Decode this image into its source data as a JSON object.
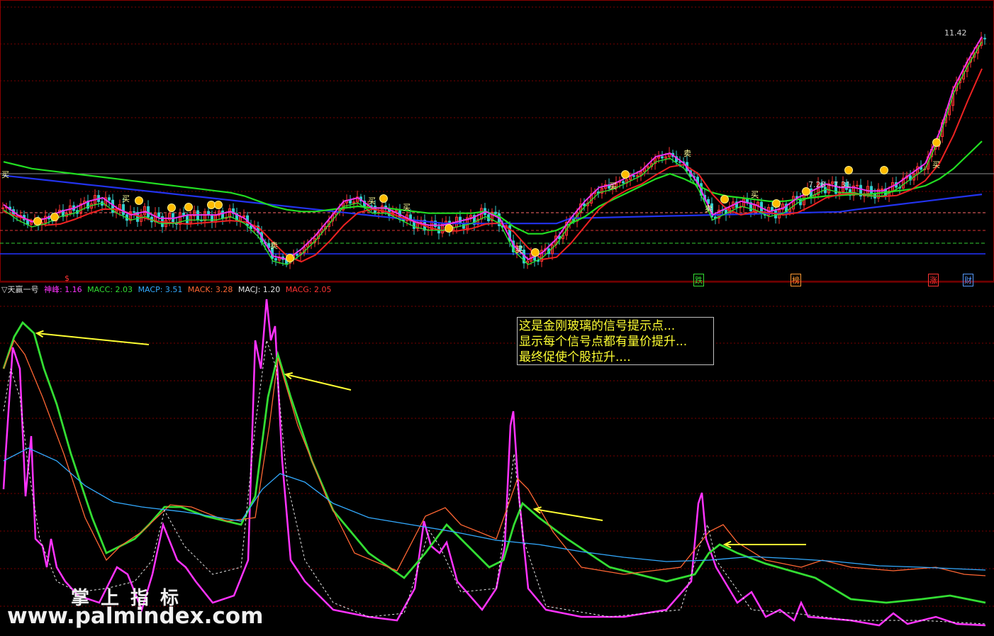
{
  "legend": {
    "title": "▽天赢一号",
    "items": [
      {
        "label": "神峰: 1.16",
        "color": "#ff33ff"
      },
      {
        "label": "MACC: 2.03",
        "color": "#33dd33"
      },
      {
        "label": "MACP: 3.51",
        "color": "#33aaff"
      },
      {
        "label": "MACK: 3.28",
        "color": "#ff6633"
      },
      {
        "label": "MACJ: 1.20",
        "color": "#e0e0e0"
      },
      {
        "label": "MACG: 2.05",
        "color": "#ff3333"
      }
    ]
  },
  "annotation": {
    "lines": [
      "这是金刚玻璃的信号提示点...",
      "显示每个信号点都有量价提升...",
      "最终促使个股拉升...."
    ]
  },
  "watermark": {
    "cn": "掌上指标",
    "url": "www.palmindex.com"
  },
  "price_labels": {
    "high": "11.42",
    "mid": "7.28 - 7.31"
  },
  "signal_marks": {
    "buy": "买",
    "sell": "卖",
    "dollar": "$"
  },
  "bottom_tags": [
    {
      "text": "跌",
      "color": "#33dd33"
    },
    {
      "text": "榜",
      "color": "#ff9933"
    },
    {
      "text": "涨",
      "color": "#ff3333"
    },
    {
      "text": "财",
      "color": "#5599ff"
    }
  ],
  "colors": {
    "up": "#ff3333",
    "down": "#33cccc",
    "ma_green": "#22dd22",
    "ma_red": "#ee2222",
    "ma_blue": "#2233ee",
    "ma_magenta": "#ee33ee",
    "grid": "#7a0000",
    "arrow": "#ffff33"
  },
  "chart_data": [
    {
      "type": "line",
      "panel": "price",
      "x": [
        0,
        20,
        40,
        60,
        80,
        100,
        120,
        140,
        160,
        180,
        200,
        220,
        240,
        260,
        280,
        300,
        320,
        340,
        360,
        380,
        400,
        420,
        440,
        460,
        480,
        500,
        520,
        540,
        560,
        580,
        600,
        620,
        640,
        660,
        680,
        700,
        720,
        740,
        760,
        780,
        800,
        820,
        840,
        860,
        880,
        900,
        920,
        940,
        960,
        980,
        1000,
        1020,
        1040,
        1060,
        1080,
        1100,
        1120,
        1140,
        1160,
        1180,
        1200,
        1220,
        1240,
        1260,
        1280,
        1300,
        1320,
        1340,
        1360,
        1380
      ],
      "series": [
        {
          "key": "close",
          "values": [
            6.4,
            6.1,
            5.9,
            6.0,
            6.2,
            6.3,
            6.5,
            6.6,
            6.3,
            6.1,
            6.2,
            6.0,
            6.0,
            6.1,
            6.1,
            6.1,
            6.2,
            6.0,
            5.6,
            4.9,
            4.8,
            5.1,
            5.5,
            6.0,
            6.5,
            6.6,
            6.3,
            6.3,
            6.1,
            5.9,
            5.8,
            5.8,
            5.9,
            6.0,
            6.2,
            6.0,
            5.2,
            4.8,
            5.0,
            5.4,
            6.0,
            6.5,
            6.9,
            7.0,
            7.2,
            7.4,
            7.8,
            7.9,
            7.6,
            7.0,
            6.1,
            6.3,
            6.5,
            6.4,
            6.2,
            6.3,
            6.6,
            6.8,
            7.0,
            6.9,
            6.9,
            6.8,
            6.8,
            7.0,
            7.3,
            7.6,
            8.5,
            9.8,
            10.6,
            11.3
          ]
        },
        {
          "key": "ma_green",
          "values": [
            7.7,
            7.6,
            7.5,
            7.45,
            7.4,
            7.35,
            7.3,
            7.25,
            7.2,
            7.15,
            7.1,
            7.05,
            7.0,
            6.95,
            6.9,
            6.85,
            6.8,
            6.7,
            6.55,
            6.4,
            6.3,
            6.25,
            6.25,
            6.3,
            6.35,
            6.4,
            6.35,
            6.35,
            6.3,
            6.25,
            6.2,
            6.2,
            6.2,
            6.2,
            6.25,
            6.1,
            5.8,
            5.6,
            5.6,
            5.7,
            5.9,
            6.1,
            6.4,
            6.6,
            6.8,
            7.0,
            7.2,
            7.35,
            7.2,
            7.0,
            6.8,
            6.7,
            6.65,
            6.6,
            6.55,
            6.55,
            6.6,
            6.65,
            6.7,
            6.72,
            6.75,
            6.75,
            6.8,
            6.85,
            6.9,
            7.0,
            7.2,
            7.5,
            7.9,
            8.3
          ]
        }
      ]
    },
    {
      "type": "line",
      "panel": "indicator",
      "series": [
        {
          "name": "神峰",
          "color": "#ff33ff"
        },
        {
          "name": "MACC",
          "color": "#33dd33"
        },
        {
          "name": "MACP",
          "color": "#33aaff"
        },
        {
          "name": "MACK",
          "color": "#ff6633"
        },
        {
          "name": "MACJ",
          "color": "#e0e0e0"
        },
        {
          "name": "MACG",
          "color": "#ff3333"
        }
      ]
    }
  ]
}
